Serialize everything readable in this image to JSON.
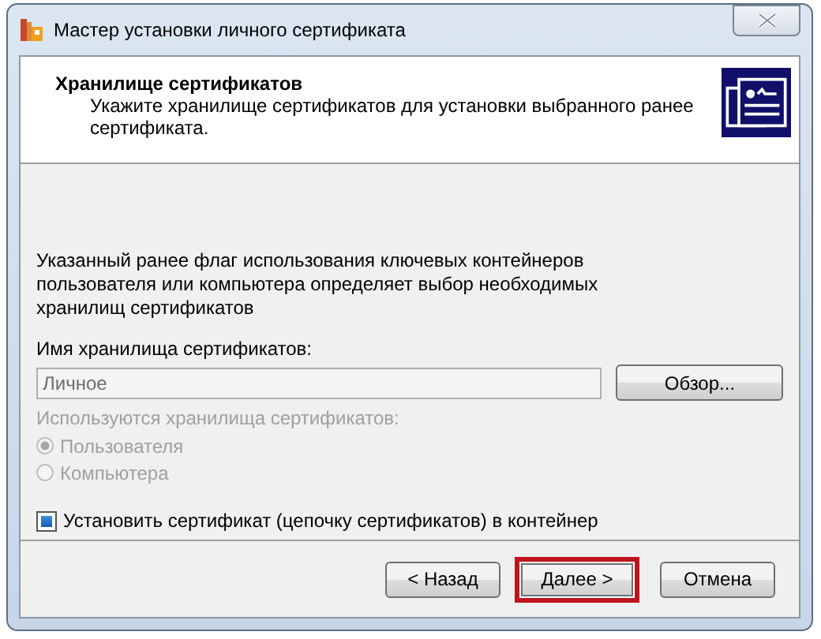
{
  "window": {
    "title": "Мастер установки личного сертификата"
  },
  "header": {
    "title": "Хранилище сертификатов",
    "subtitle": "Укажите хранилище сертификатов для установки выбранного ранее сертификата."
  },
  "description": "Указанный ранее флаг использования ключевых контейнеров пользователя или компьютера определяет выбор необходимых хранилищ сертификатов",
  "store_field": {
    "label": "Имя хранилища сертификатов:",
    "value": "Личное",
    "disabled": true
  },
  "browse_button": "Обзор...",
  "store_type": {
    "label": "Используются хранилища сертификатов:",
    "disabled": true,
    "options": [
      {
        "label": "Пользователя",
        "selected": true
      },
      {
        "label": "Компьютера",
        "selected": false
      }
    ]
  },
  "install_checkbox": {
    "label": "Установить сертификат (цепочку сертификатов) в контейнер",
    "checked": true
  },
  "buttons": [
    {
      "label": "< Назад",
      "highlighted": false
    },
    {
      "label": "Далее >",
      "highlighted": true
    },
    {
      "label": "Отмена",
      "highlighted": false
    }
  ]
}
